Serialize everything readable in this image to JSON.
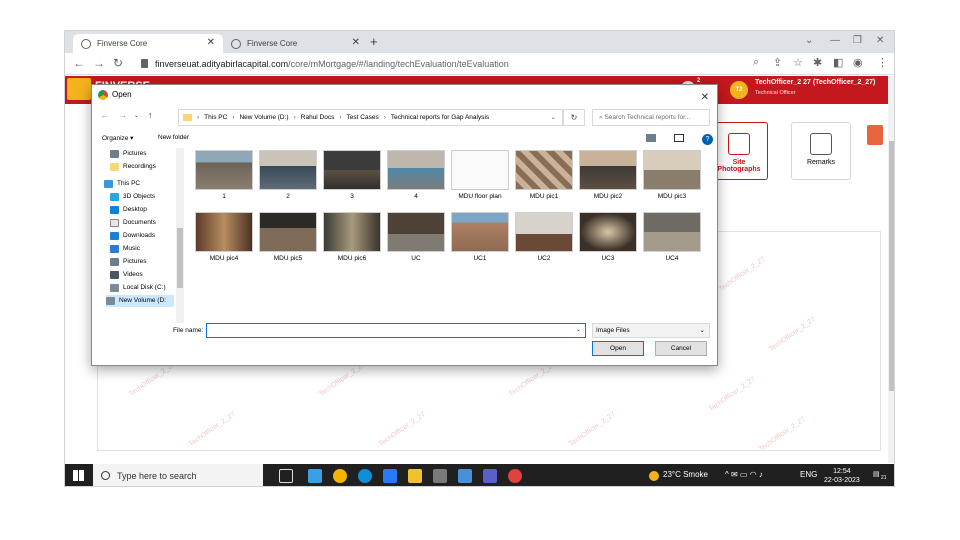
{
  "browser": {
    "tabs": [
      {
        "label": "Finverse Core",
        "active": true
      },
      {
        "label": "Finverse Core",
        "active": false
      }
    ],
    "url_host": "finverseuat.adityabirlacapital.com",
    "url_path": "/core/mMortgage/#/landing/techEvaluation/teEvaluation"
  },
  "app": {
    "name": "FINVERSE",
    "user_initials": "T2",
    "user_name": "TechOfficer_2 27 (TechOfficer_2_27)",
    "user_role": "Technical Officer",
    "notification_count": "2",
    "cards": [
      {
        "label": "Site Photographs",
        "active": true
      },
      {
        "label": "Remarks",
        "active": false
      }
    ],
    "watermark": "TechOfficer_2_27"
  },
  "dialog": {
    "title": "Open",
    "breadcrumb": [
      "This PC",
      "New Volume (D:)",
      "Rahul Docs",
      "Test Cases",
      "Technical reports for Gap Analysis"
    ],
    "search_placeholder": "Search Technical reports for...",
    "organize_label": "Organize ▾",
    "new_folder_label": "New folder",
    "tree": [
      "Pictures",
      "Recordings",
      "This PC",
      "3D Objects",
      "Desktop",
      "Documents",
      "Downloads",
      "Music",
      "Pictures",
      "Videos",
      "Local Disk (C:)",
      "New Volume (D:"
    ],
    "files": [
      "1",
      "2",
      "3",
      "4",
      "MDU floor plan",
      "MDU pic1",
      "MDU pic2",
      "MDU pic3",
      "MDU pic4",
      "MDU pic5",
      "MDU pic6",
      "UC",
      "UC1",
      "UC2",
      "UC3",
      "UC4"
    ],
    "file_name_label": "File name:",
    "file_name_value": "",
    "file_type": "Image Files",
    "open_label": "Open",
    "cancel_label": "Cancel"
  },
  "taskbar": {
    "search_placeholder": "Type here to search",
    "weather": "23°C Smoke",
    "lang": "ENG",
    "time": "12:54",
    "date": "22-03-2023",
    "notif_count": "21"
  }
}
